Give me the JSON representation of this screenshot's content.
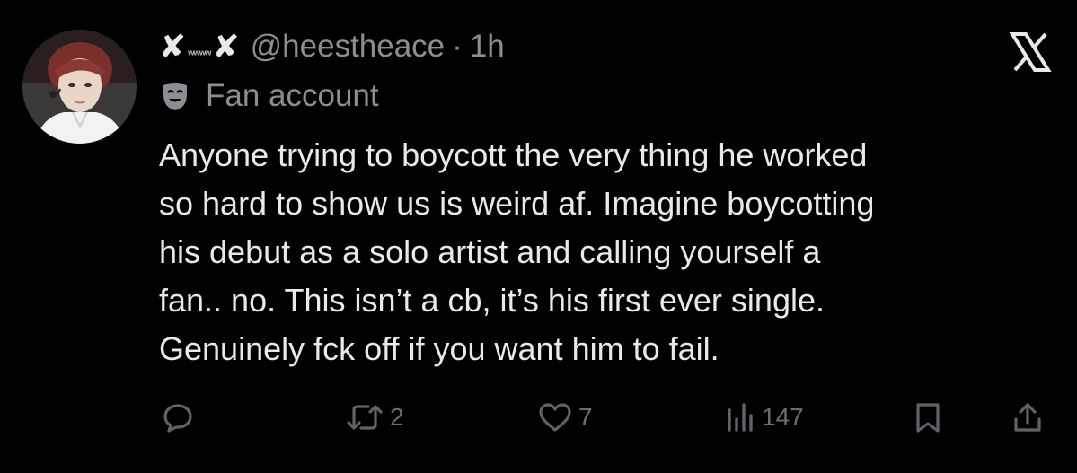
{
  "author": {
    "name_mark_left": "✘",
    "name_squiggle": "ʷʷʷʷ",
    "name_mark_right": "✘",
    "handle": "@heestheace",
    "separator": "·",
    "time": "1h",
    "label": "Fan account",
    "avatar_icon": "profile-photo"
  },
  "platform_logo": "X",
  "tweet": {
    "lines": [
      "Anyone trying to boycott the very thing he worked",
      "so hard to show us is weird af. Imagine boycotting",
      "his debut as a solo artist and calling yourself a",
      "fan.. no. This isn’t a cb, it’s his first ever single.",
      "Genuinely fck off if you want him to fail."
    ]
  },
  "actions": {
    "reply_count": "",
    "retweet_count": "2",
    "like_count": "7",
    "view_count": "147"
  },
  "colors": {
    "background": "#000000",
    "text": "#e7e9ea",
    "secondary": "#8b8f93",
    "icon": "#5f6368"
  }
}
